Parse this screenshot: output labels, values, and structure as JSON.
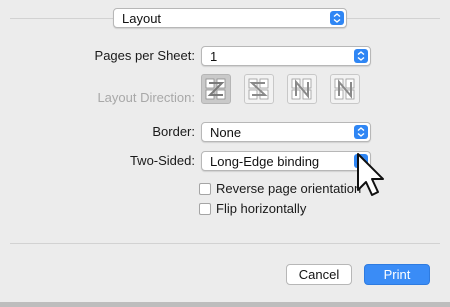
{
  "panel_selector": {
    "value": "Layout"
  },
  "pages_per_sheet": {
    "label": "Pages per Sheet:",
    "value": "1"
  },
  "layout_direction": {
    "label": "Layout Direction:",
    "options": [
      "z-order",
      "reverse-s-order",
      "reverse-n-order",
      "n-order"
    ],
    "selected": "z-order"
  },
  "border": {
    "label": "Border:",
    "value": "None"
  },
  "two_sided": {
    "label": "Two-Sided:",
    "value": "Long-Edge binding"
  },
  "options": {
    "reverse_orientation": {
      "label": "Reverse page orientation",
      "checked": false
    },
    "flip_horizontally": {
      "label": "Flip horizontally",
      "checked": false
    }
  },
  "buttons": {
    "cancel": "Cancel",
    "print": "Print"
  },
  "colors": {
    "accent": "#2f86f4",
    "background": "#ececec"
  }
}
